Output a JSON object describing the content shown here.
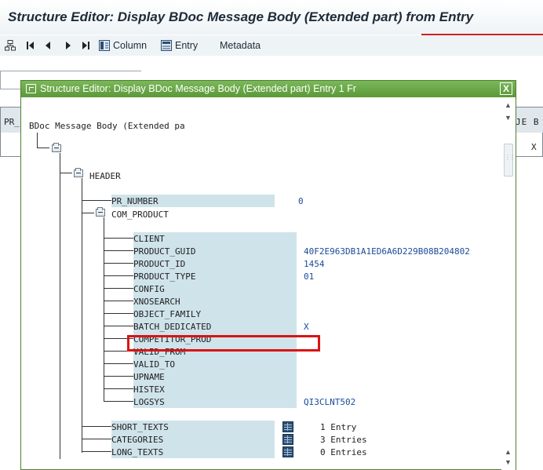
{
  "window": {
    "title": "Structure Editor: Display BDoc Message Body (Extended part) from Entry"
  },
  "toolbar": {
    "column_label": "Column",
    "entry_label": "Entry",
    "metadata_label": "Metadata"
  },
  "background": {
    "left_header": "PR_",
    "right_header": "JE B",
    "right_cell": "X"
  },
  "dialog": {
    "title": "Structure Editor: Display BDoc Message Body (Extended part) Entry 1 Fr",
    "close_label": "X",
    "root_label": "BDoc Message Body (Extended pa",
    "header_label": "HEADER",
    "pr_number": {
      "name": "PR_NUMBER",
      "value": "0"
    },
    "com_product_label": "COM_PRODUCT",
    "fields": [
      {
        "name": "CLIENT",
        "value": ""
      },
      {
        "name": "PRODUCT_GUID",
        "value": "40F2E963DB1A1ED6A6D229B08B204802"
      },
      {
        "name": "PRODUCT_ID",
        "value": "1454"
      },
      {
        "name": "PRODUCT_TYPE",
        "value": "01"
      },
      {
        "name": "CONFIG",
        "value": ""
      },
      {
        "name": "XNOSEARCH",
        "value": ""
      },
      {
        "name": "OBJECT_FAMILY",
        "value": ""
      },
      {
        "name": "BATCH_DEDICATED",
        "value": "X"
      },
      {
        "name": "COMPETITOR_PROD",
        "value": ""
      },
      {
        "name": "VALID_FROM",
        "value": ""
      },
      {
        "name": "VALID_TO",
        "value": ""
      },
      {
        "name": "UPNAME",
        "value": ""
      },
      {
        "name": "HISTEX",
        "value": ""
      },
      {
        "name": "LOGSYS",
        "value": "QI3CLNT502"
      }
    ],
    "tables": [
      {
        "name": "SHORT_TEXTS",
        "value": "1 Entry"
      },
      {
        "name": "CATEGORIES",
        "value": "3 Entries"
      },
      {
        "name": "LONG_TEXTS",
        "value": "0 Entries"
      }
    ],
    "highlighted_field": "BATCH_DEDICATED",
    "highlight_color": "#d81414"
  }
}
